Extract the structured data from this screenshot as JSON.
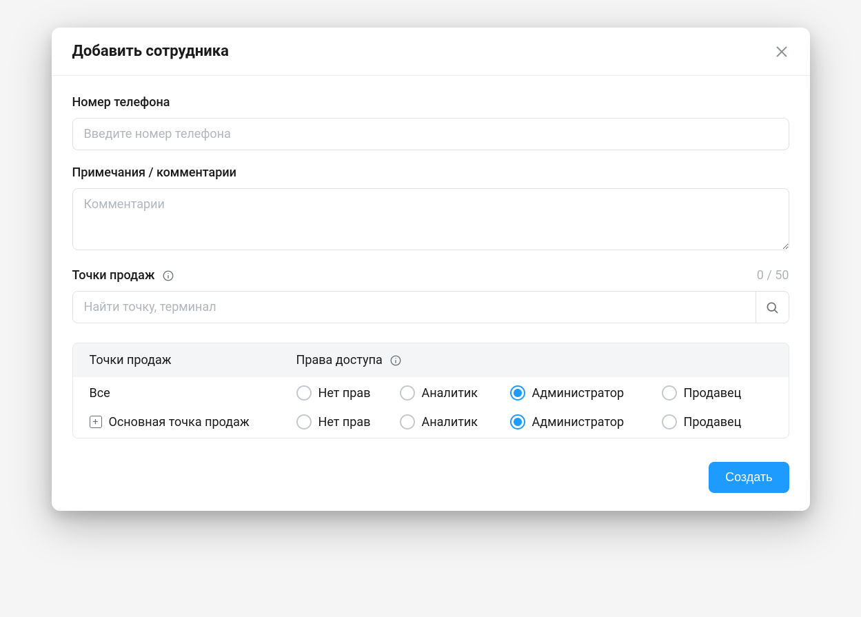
{
  "header": {
    "title": "Добавить сотрудника"
  },
  "form": {
    "phone": {
      "label": "Номер телефона",
      "placeholder": "Введите номер телефона",
      "value": ""
    },
    "comments": {
      "label": "Примечания / комментарии",
      "placeholder": "Комментарии",
      "value": "",
      "counter": "0 / 50"
    },
    "salespoints": {
      "label": "Точки продаж",
      "search_placeholder": "Найти точку, терминал",
      "search_value": ""
    }
  },
  "table": {
    "head": {
      "col1": "Точки продаж",
      "col2": "Права доступа"
    },
    "roles": [
      "Нет прав",
      "Аналитик",
      "Администратор",
      "Продавец"
    ],
    "rows": [
      {
        "name": "Все",
        "expandable": false,
        "selected_role_index": 2
      },
      {
        "name": "Основная точка продаж",
        "expandable": true,
        "selected_role_index": 2
      }
    ]
  },
  "footer": {
    "submit_label": "Создать"
  }
}
